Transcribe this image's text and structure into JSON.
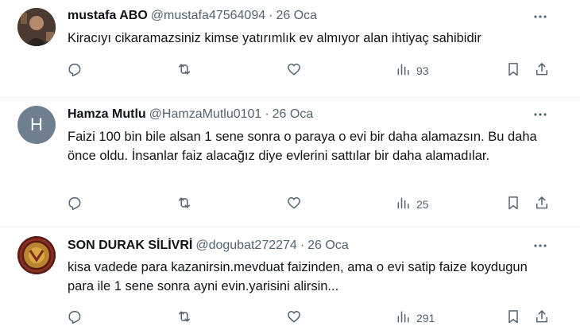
{
  "tweets": [
    {
      "name": "mustafa ABO",
      "handle": "@mustafa47564094",
      "separator": "·",
      "date": "26 Oca",
      "text": "Kiracıyı cikaramazsiniz kimse yatırımlık ev almıyor alan ihtiyaç sahibidir",
      "views": "93",
      "avatar_style": "photo-dark"
    },
    {
      "name": "Hamza Mutlu",
      "handle": "@HamzaMutlu0101",
      "separator": "·",
      "date": "26 Oca",
      "text": "Faizi 100 bin bile alsan 1 sene sonra o paraya o evi bir daha alamazsın. Bu daha önce oldu. İnsanlar faiz alacağız diye evlerini sattılar bir daha alamadılar.",
      "views": "25",
      "avatar_letter": "H",
      "avatar_color": "#6e8090"
    },
    {
      "name": "SON DURAK SİLİVRİ",
      "handle": "@dogubat272274",
      "separator": "·",
      "date": "26 Oca",
      "text": "kisa vadede para kazanirsin.mevduat faizinden, ama o evi satip faize koydugun para ile 1 sene sonra  ayni evin.yarisini alirsin...",
      "views": "291",
      "avatar_style": "photo-red"
    }
  ],
  "icons": {
    "reply": "reply-icon",
    "retweet": "retweet-icon",
    "like": "like-icon",
    "views": "views-icon",
    "bookmark": "bookmark-icon",
    "share": "share-icon",
    "more": "more-icon"
  },
  "colors": {
    "text": "#0f1419",
    "secondary": "#536471",
    "border": "#eff3f4"
  }
}
